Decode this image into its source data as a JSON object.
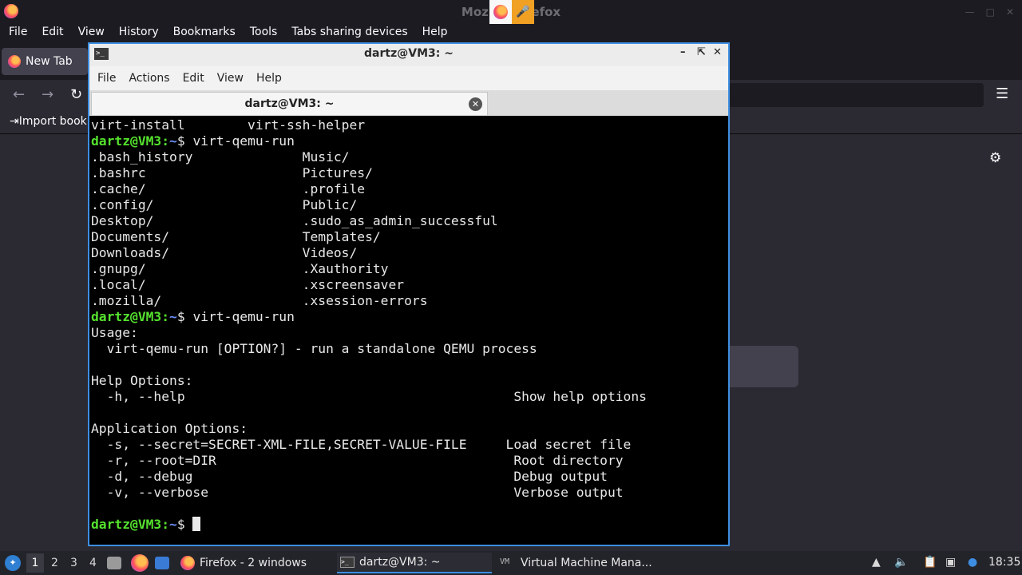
{
  "firefox": {
    "window_title": "Mozilla Firefox",
    "menu": [
      "File",
      "Edit",
      "View",
      "History",
      "Bookmarks",
      "Tools",
      "Tabs sharing devices",
      "Help"
    ],
    "tab_label": "New Tab",
    "bookmark_label": "Import bookm"
  },
  "terminal": {
    "window_title": "dartz@VM3: ~",
    "menu": [
      "File",
      "Actions",
      "Edit",
      "View",
      "Help"
    ],
    "tab_label": "dartz@VM3: ~",
    "lines": [
      {
        "kind": "text",
        "text": "virt-install        virt-ssh-helper"
      },
      {
        "kind": "prompt",
        "user": "dartz@VM3",
        "path": "~",
        "cmd": " virt-qemu-run"
      },
      {
        "kind": "text",
        "text": ".bash_history              Music/"
      },
      {
        "kind": "text",
        "text": ".bashrc                    Pictures/"
      },
      {
        "kind": "text",
        "text": ".cache/                    .profile"
      },
      {
        "kind": "text",
        "text": ".config/                   Public/"
      },
      {
        "kind": "text",
        "text": "Desktop/                   .sudo_as_admin_successful"
      },
      {
        "kind": "text",
        "text": "Documents/                 Templates/"
      },
      {
        "kind": "text",
        "text": "Downloads/                 Videos/"
      },
      {
        "kind": "text",
        "text": ".gnupg/                    .Xauthority"
      },
      {
        "kind": "text",
        "text": ".local/                    .xscreensaver"
      },
      {
        "kind": "text",
        "text": ".mozilla/                  .xsession-errors"
      },
      {
        "kind": "prompt",
        "user": "dartz@VM3",
        "path": "~",
        "cmd": " virt-qemu-run"
      },
      {
        "kind": "text",
        "text": "Usage:"
      },
      {
        "kind": "text",
        "text": "  virt-qemu-run [OPTION?] - run a standalone QEMU process"
      },
      {
        "kind": "text",
        "text": ""
      },
      {
        "kind": "text",
        "text": "Help Options:"
      },
      {
        "kind": "text",
        "text": "  -h, --help                                          Show help options"
      },
      {
        "kind": "text",
        "text": ""
      },
      {
        "kind": "text",
        "text": "Application Options:"
      },
      {
        "kind": "text",
        "text": "  -s, --secret=SECRET-XML-FILE,SECRET-VALUE-FILE     Load secret file"
      },
      {
        "kind": "text",
        "text": "  -r, --root=DIR                                      Root directory"
      },
      {
        "kind": "text",
        "text": "  -d, --debug                                         Debug output"
      },
      {
        "kind": "text",
        "text": "  -v, --verbose                                       Verbose output"
      },
      {
        "kind": "text",
        "text": ""
      },
      {
        "kind": "prompt_cursor",
        "user": "dartz@VM3",
        "path": "~",
        "cmd": " "
      }
    ]
  },
  "taskbar": {
    "workspaces": [
      "1",
      "2",
      "3",
      "4"
    ],
    "tasks": [
      {
        "label": "Firefox - 2 windows",
        "icon": "firefox-icon"
      },
      {
        "label": "dartz@VM3: ~",
        "icon": "terminal-icon"
      },
      {
        "label": "Virtual Machine Mana...",
        "icon": "vmm-icon"
      }
    ],
    "clock": "18:35"
  }
}
